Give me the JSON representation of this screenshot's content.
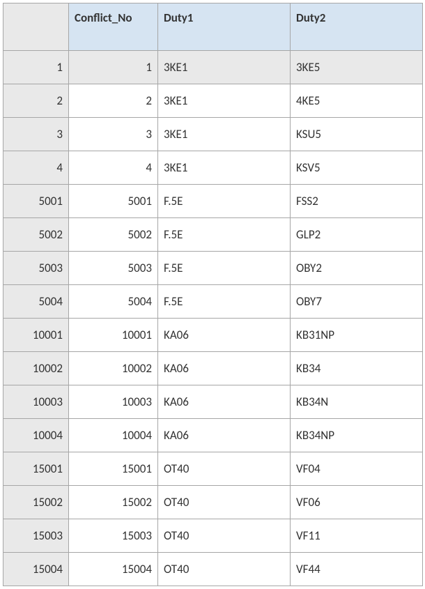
{
  "table": {
    "columns": [
      {
        "key": "conflict_no",
        "label": "Conflict_No",
        "align": "right"
      },
      {
        "key": "duty1",
        "label": "Duty1",
        "align": "left"
      },
      {
        "key": "duty2",
        "label": "Duty2",
        "align": "left"
      }
    ],
    "rows": [
      {
        "id": "1",
        "conflict_no": "1",
        "duty1": "3KE1",
        "duty2": "3KE5",
        "selected": true
      },
      {
        "id": "2",
        "conflict_no": "2",
        "duty1": "3KE1",
        "duty2": "4KE5",
        "selected": false
      },
      {
        "id": "3",
        "conflict_no": "3",
        "duty1": "3KE1",
        "duty2": "KSU5",
        "selected": false
      },
      {
        "id": "4",
        "conflict_no": "4",
        "duty1": "3KE1",
        "duty2": "KSV5",
        "selected": false
      },
      {
        "id": "5001",
        "conflict_no": "5001",
        "duty1": "F.5E",
        "duty2": "FSS2",
        "selected": false
      },
      {
        "id": "5002",
        "conflict_no": "5002",
        "duty1": "F.5E",
        "duty2": "GLP2",
        "selected": false
      },
      {
        "id": "5003",
        "conflict_no": "5003",
        "duty1": "F.5E",
        "duty2": "OBY2",
        "selected": false
      },
      {
        "id": "5004",
        "conflict_no": "5004",
        "duty1": "F.5E",
        "duty2": "OBY7",
        "selected": false
      },
      {
        "id": "10001",
        "conflict_no": "10001",
        "duty1": "KA06",
        "duty2": "KB31NP",
        "selected": false
      },
      {
        "id": "10002",
        "conflict_no": "10002",
        "duty1": "KA06",
        "duty2": "KB34",
        "selected": false
      },
      {
        "id": "10003",
        "conflict_no": "10003",
        "duty1": "KA06",
        "duty2": "KB34N",
        "selected": false
      },
      {
        "id": "10004",
        "conflict_no": "10004",
        "duty1": "KA06",
        "duty2": "KB34NP",
        "selected": false
      },
      {
        "id": "15001",
        "conflict_no": "15001",
        "duty1": "OT40",
        "duty2": "VF04",
        "selected": false
      },
      {
        "id": "15002",
        "conflict_no": "15002",
        "duty1": "OT40",
        "duty2": "VF06",
        "selected": false
      },
      {
        "id": "15003",
        "conflict_no": "15003",
        "duty1": "OT40",
        "duty2": "VF11",
        "selected": false
      },
      {
        "id": "15004",
        "conflict_no": "15004",
        "duty1": "OT40",
        "duty2": "VF44",
        "selected": false
      }
    ]
  }
}
